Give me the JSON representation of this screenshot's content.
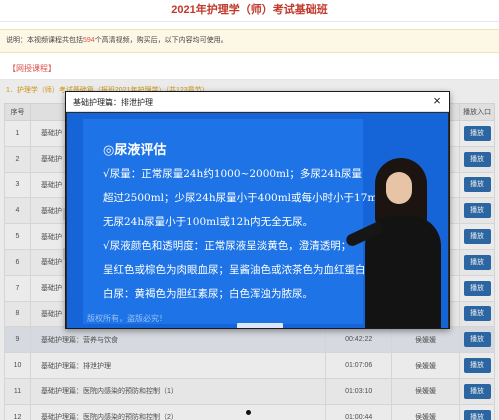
{
  "page": {
    "title": "2021年护理学（师）考试基础班"
  },
  "notice": {
    "prefix": "说明：本视频课程共包括",
    "count": "594",
    "suffix": "个高清视频，购买后，以下内容均可使用。"
  },
  "section": {
    "label": "【网授课程】"
  },
  "course": {
    "line": "1．护理学（师）考试基础篇（报班2021年护理学）（共123章节）"
  },
  "table": {
    "headers": [
      "序号",
      "",
      "",
      "",
      "播放入口"
    ],
    "rows": [
      {
        "no": "1",
        "title": "基础护",
        "duration": "",
        "teacher": "",
        "action": "播放"
      },
      {
        "no": "2",
        "title": "基础护",
        "duration": "",
        "teacher": "",
        "action": "播放"
      },
      {
        "no": "3",
        "title": "基础护",
        "duration": "",
        "teacher": "",
        "action": "播放"
      },
      {
        "no": "4",
        "title": "基础护",
        "duration": "",
        "teacher": "",
        "action": "播放"
      },
      {
        "no": "5",
        "title": "基础护",
        "duration": "",
        "teacher": "",
        "action": "播放"
      },
      {
        "no": "6",
        "title": "基础护",
        "duration": "",
        "teacher": "",
        "action": "播放"
      },
      {
        "no": "7",
        "title": "基础护",
        "duration": "",
        "teacher": "",
        "action": "播放"
      },
      {
        "no": "8",
        "title": "基础护",
        "duration": "",
        "teacher": "",
        "action": "播放"
      },
      {
        "no": "9",
        "title": "基础护理篇：营养与饮食",
        "duration": "00:42:22",
        "teacher": "侯媛媛",
        "action": "播放"
      },
      {
        "no": "10",
        "title": "基础护理篇：排泄护理",
        "duration": "01:07:06",
        "teacher": "侯媛媛",
        "action": "播放"
      },
      {
        "no": "11",
        "title": "基础护理篇：医院内感染的预防和控制（1）",
        "duration": "01:03:10",
        "teacher": "侯媛媛",
        "action": "播放"
      },
      {
        "no": "12",
        "title": "基础护理篇：医院内感染的预防和控制（2）",
        "duration": "01:00:44",
        "teacher": "侯媛媛",
        "action": "播放"
      }
    ]
  },
  "modal": {
    "title": "基础护理篇：排泄护理",
    "close": "×",
    "slide": {
      "heading": "◎尿液评估",
      "line1": "√尿量：正常尿量24h约1000~2000ml；多尿24h尿量",
      "line2": "超过2500ml；少尿24h尿量小于400ml或每小时小于17ml；",
      "line3": "无尿24h尿量小于100ml或12h内无全无尿。",
      "line4": "√尿液颜色和透明度：正常尿液呈淡黄色，澄清透明；",
      "line5": "呈红色或棕色为肉眼血尿；呈酱油色或浓茶色为血红蛋白尿；",
      "line6": "白尿：黄褐色为胆红素尿；白色浑浊为脓尿。",
      "watermark": "版权所有，盗版必究！"
    }
  }
}
